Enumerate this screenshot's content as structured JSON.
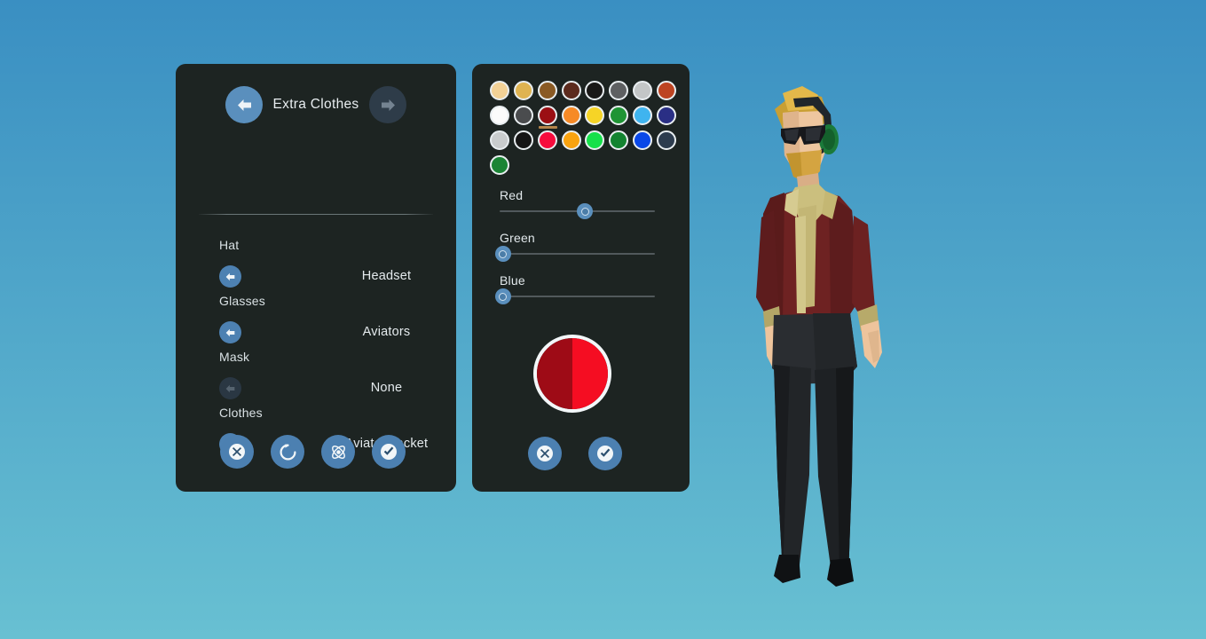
{
  "background": {
    "top_color": "#3a8fc2",
    "bottom_color": "#68c0d2"
  },
  "left_panel": {
    "header": {
      "title": "Extra Clothes",
      "prev_icon": "arrow-left-icon",
      "next_icon": "arrow-right-icon",
      "prev_enabled": true,
      "next_enabled": false
    },
    "rows": [
      {
        "label": "Hat",
        "value": "Headset",
        "color": "#0f7a1c",
        "prev_enabled": true,
        "next_enabled": true
      },
      {
        "label": "Glasses",
        "value": "Aviators",
        "color": "#8d1410",
        "prev_enabled": true,
        "next_enabled": true
      },
      {
        "label": "Mask",
        "value": "None",
        "color": "#39baf5",
        "prev_enabled": false,
        "next_enabled": true
      },
      {
        "label": "Clothes",
        "value": "Aviator Jacket",
        "color": "#6b4033",
        "prev_enabled": true,
        "next_enabled": true
      }
    ],
    "actions": [
      {
        "name": "cancel-button",
        "icon": "circle-x-icon",
        "label": "Cancel"
      },
      {
        "name": "reset-button",
        "icon": "refresh-icon",
        "label": "Reset"
      },
      {
        "name": "randomize-button",
        "icon": "atom-icon",
        "label": "Randomize"
      },
      {
        "name": "confirm-button",
        "icon": "circle-check-icon",
        "label": "Confirm"
      }
    ]
  },
  "right_panel": {
    "palette": {
      "selected_index": 10,
      "swatches": [
        "#f2d196",
        "#dfb351",
        "#8a5a24",
        "#5c2a1d",
        "#191817",
        "#5e6062",
        "#c3c6c7",
        "#bd4422",
        "#fbfbfb",
        "#4a4c4e",
        "#9b0f14",
        "#f68a26",
        "#f6d426",
        "#1f9434",
        "#3fb4ef",
        "#2a2f85",
        "#c9cccd",
        "#151515",
        "#f70c3d",
        "#f9a310",
        "#16e04a",
        "#138330",
        "#0a48e8",
        "#2d3c4e",
        "#1b8435"
      ]
    },
    "sliders": [
      {
        "label": "Red",
        "value": 55
      },
      {
        "label": "Green",
        "value": 2
      },
      {
        "label": "Blue",
        "value": 2
      }
    ],
    "preview": {
      "old_color": "#9e0b16",
      "new_color": "#f50d22"
    },
    "actions": [
      {
        "name": "color-cancel-button",
        "icon": "circle-x-icon",
        "label": "Cancel"
      },
      {
        "name": "color-confirm-button",
        "icon": "circle-check-icon",
        "label": "Confirm"
      }
    ]
  },
  "character": {
    "hair_color": "#d8a93a",
    "skin_color": "#edc49e",
    "jacket_color": "#6e2222",
    "scarf_color": "#cbbf7e",
    "pants_color": "#2a2d31",
    "headset_color": "#1b7a3a",
    "glasses_color": "#17181c"
  }
}
